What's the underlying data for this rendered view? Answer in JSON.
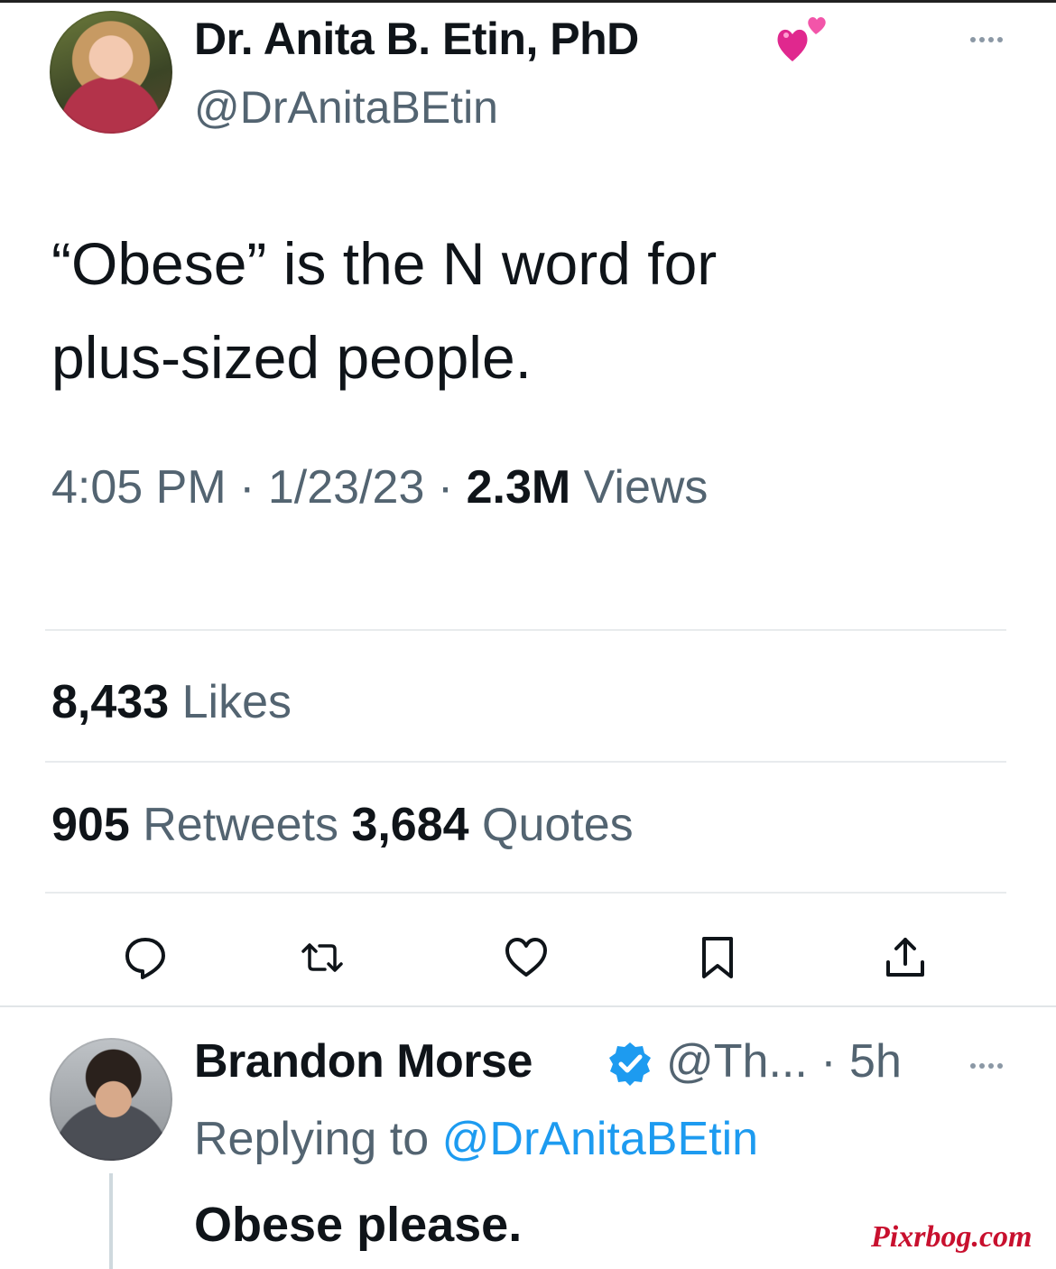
{
  "tweet": {
    "display_name": "Dr. Anita B. Etin, PhD",
    "name_emoji": "two-hearts-icon",
    "handle": "@DrAnitaBEtin",
    "text_line1": "“Obese” is the N word for",
    "text_line2": "plus-sized people.",
    "time": "4:05 PM",
    "date": "1/23/23",
    "views_count": "2.3M",
    "views_label": "Views",
    "separator": " · ",
    "likes_count": "8,433",
    "likes_label": "Likes",
    "retweets_count": "905",
    "retweets_label": "Retweets",
    "quotes_count": "3,684",
    "quotes_label": "Quotes"
  },
  "actions": [
    "reply-icon",
    "retweet-icon",
    "like-icon",
    "bookmark-icon",
    "share-icon"
  ],
  "reply": {
    "display_name": "Brandon Morse",
    "handle_time": "@Th... · 5h",
    "replying_prefix": "Replying to",
    "replying_to": "@DrAnitaBEtin",
    "text": "Obese please."
  },
  "watermark": "Pixrbog.com",
  "colors": {
    "text": "#0f1419",
    "secondary": "#536471",
    "link": "#1d9bf0",
    "heart": "#e0288e",
    "watermark": "#c8102e"
  }
}
